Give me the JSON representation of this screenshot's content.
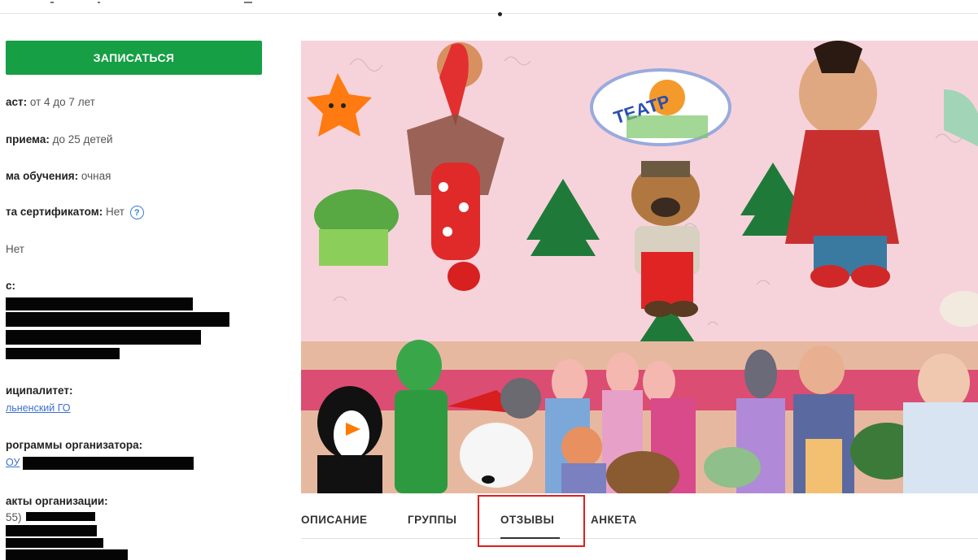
{
  "enroll_button": {
    "label": "ЗАПИСАТЬСЯ",
    "color": "#169f45"
  },
  "info": {
    "age": {
      "label": "аст:",
      "value": "от 4 до 7 лет"
    },
    "capacity": {
      "label": "приема:",
      "value": "до 25 детей"
    },
    "form": {
      "label": "ма обучения:",
      "value": "очная"
    },
    "certificate": {
      "label": "та сертификатом:",
      "value": "Нет",
      "help_icon": "?"
    },
    "extra": {
      "value": "Нет"
    },
    "address": {
      "label": "с:"
    },
    "municipality": {
      "label": "иципалитет:",
      "link": "льненский ГО"
    },
    "organizer_programs": {
      "label": "рограммы организатора:",
      "link": "ОУ"
    },
    "contacts": {
      "label": "акты организации:",
      "phone_prefix": "55)"
    }
  },
  "photo": {
    "alt_text": "ТЕАТР"
  },
  "tabs": [
    {
      "label": "ОПИСАНИЕ"
    },
    {
      "label": "ГРУППЫ"
    },
    {
      "label": "ОТЗЫВЫ",
      "active": true
    },
    {
      "label": "АНКЕТА"
    }
  ],
  "colors": {
    "accent_green": "#169f45",
    "link_blue": "#3b6fd1",
    "highlight_red": "#e21d1d"
  }
}
